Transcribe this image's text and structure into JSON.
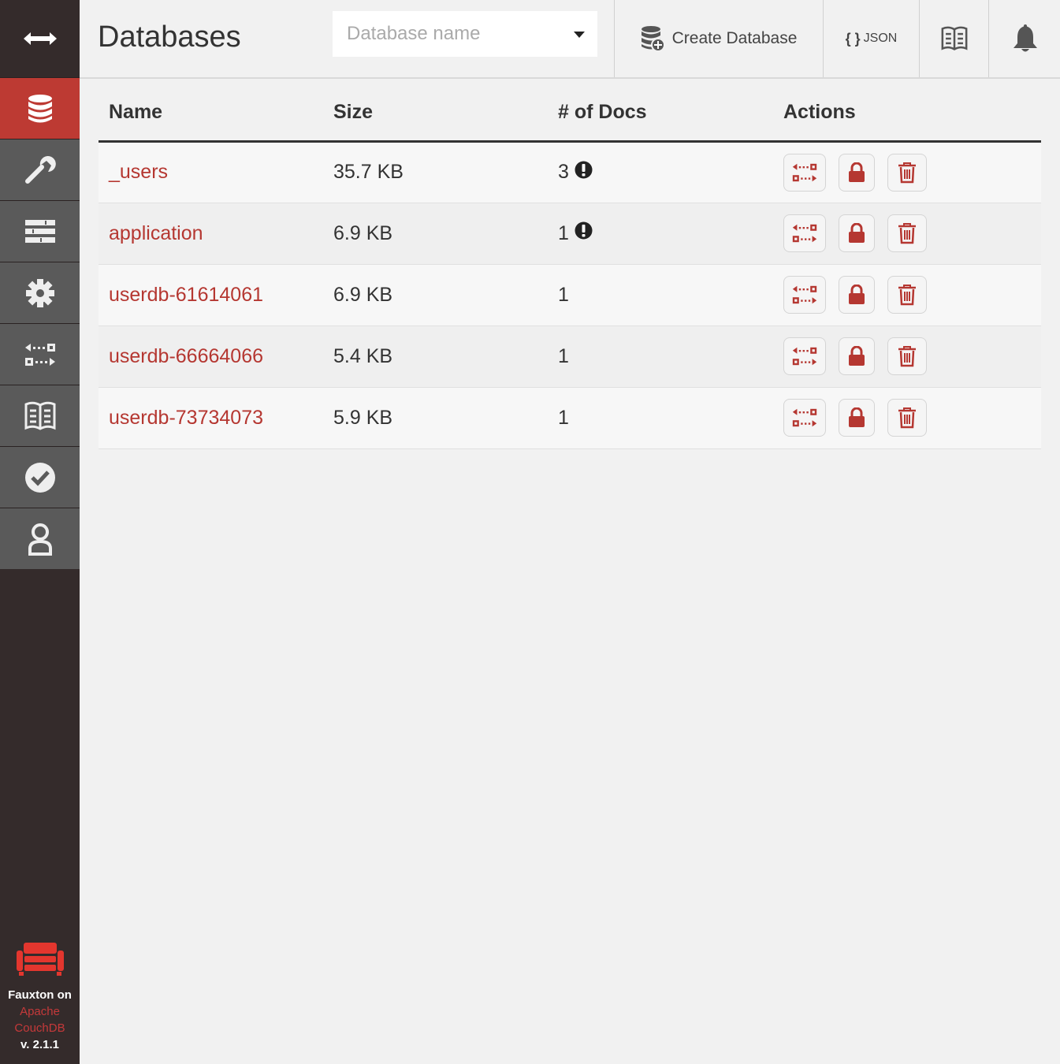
{
  "colors": {
    "sidebar_bg": "#342b2b",
    "nav_item_bg": "#5a5a5a",
    "accent": "#bd3a33",
    "link": "#b53731"
  },
  "sidebar": {
    "toggle_icon": "expand-arrows-icon",
    "items": [
      {
        "id": "databases",
        "icon": "database-icon",
        "active": true
      },
      {
        "id": "setup",
        "icon": "wrench-icon",
        "active": false
      },
      {
        "id": "active-tasks",
        "icon": "tasks-icon",
        "active": false
      },
      {
        "id": "config",
        "icon": "gear-icon",
        "active": false
      },
      {
        "id": "replication",
        "icon": "replication-icon",
        "active": false
      },
      {
        "id": "documentation",
        "icon": "book-icon",
        "active": false
      },
      {
        "id": "verify",
        "icon": "checkmark-icon",
        "active": false
      },
      {
        "id": "user",
        "icon": "user-icon",
        "active": false
      }
    ],
    "brand": {
      "line1": "Fauxton on",
      "line2": "Apache",
      "line3": "CouchDB",
      "version": "v. 2.1.1"
    }
  },
  "header": {
    "title": "Databases",
    "search_placeholder": "Database name",
    "create_label": "Create Database",
    "json_braces": "{ }",
    "json_label": "JSON"
  },
  "table": {
    "columns": [
      "Name",
      "Size",
      "# of Docs",
      "Actions"
    ],
    "rows": [
      {
        "name": "_users",
        "size": "35.7 KB",
        "docs": "3",
        "warning": true
      },
      {
        "name": "application",
        "size": "6.9 KB",
        "docs": "1",
        "warning": true
      },
      {
        "name": "userdb-61614061",
        "size": "6.9 KB",
        "docs": "1",
        "warning": false
      },
      {
        "name": "userdb-66664066",
        "size": "5.4 KB",
        "docs": "1",
        "warning": false
      },
      {
        "name": "userdb-73734073",
        "size": "5.9 KB",
        "docs": "1",
        "warning": false
      }
    ]
  }
}
